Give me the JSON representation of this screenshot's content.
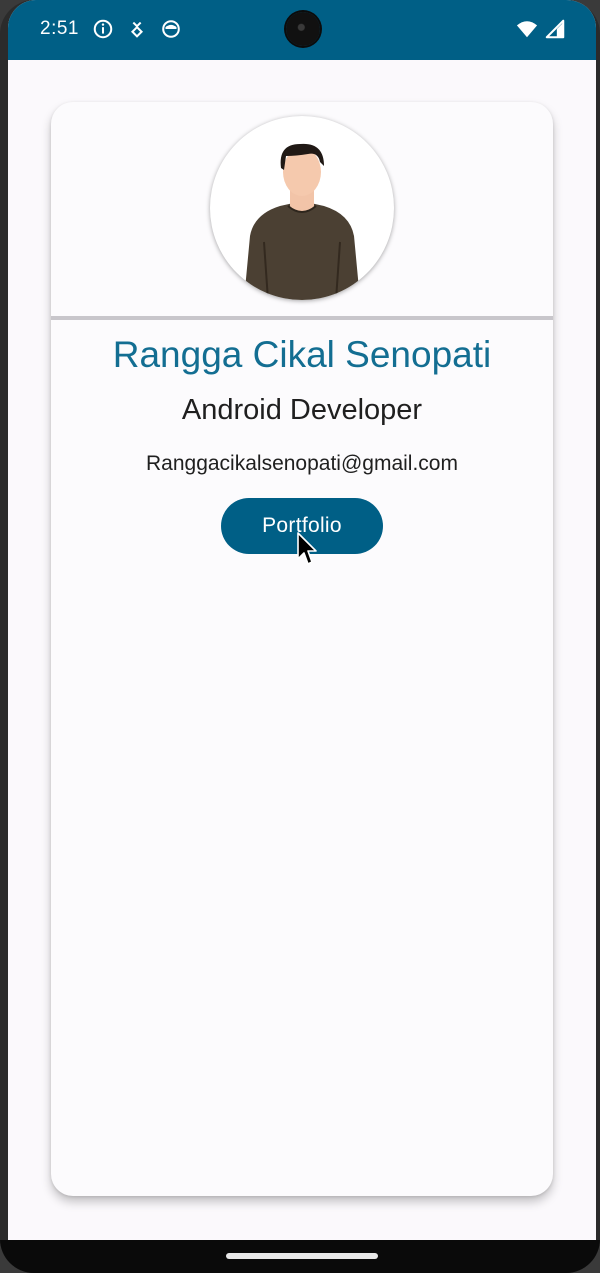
{
  "status_bar": {
    "time": "2:51",
    "color": "#005f86",
    "left_icons": [
      "info-icon",
      "download-notification-icon",
      "app-notification-icon"
    ],
    "right_icons": [
      "wifi-icon",
      "cellular-signal-icon"
    ]
  },
  "profile": {
    "avatar_icon": "person-avatar-illustration",
    "name": "Rangga Cikal Senopati",
    "role": "Android Developer",
    "email": "Ranggacikalsenopati@gmail.com",
    "portfolio_label": "Portfolio",
    "accent_color": "#136e92",
    "button_color": "#005f86"
  }
}
